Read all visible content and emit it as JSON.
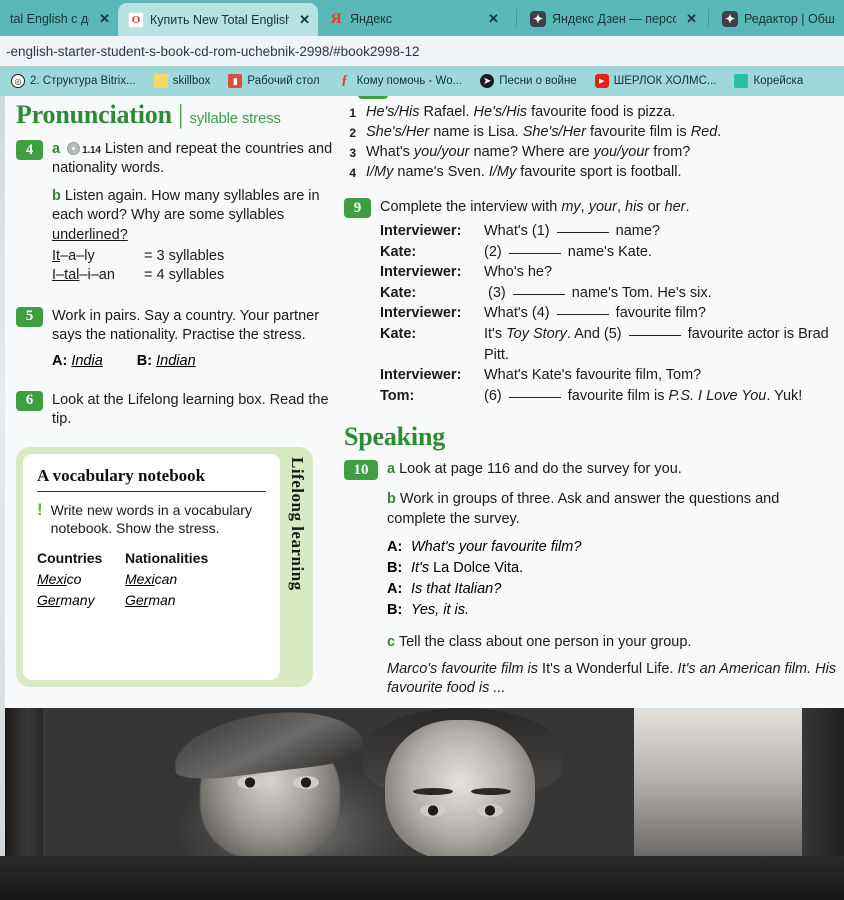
{
  "browser": {
    "tabs": [
      {
        "title": "tal English с дос",
        "icon": "none-icon",
        "active": false,
        "close": "✕"
      },
      {
        "title": "Купить New Total English",
        "icon": "opera-icon",
        "active": true,
        "close": "✕"
      },
      {
        "title": "Яндекс",
        "icon": "yandex-icon",
        "active": false,
        "close": "✕"
      },
      {
        "title": "Яндекс Дзен — персона",
        "icon": "zen-icon",
        "active": false,
        "close": "✕"
      },
      {
        "title": "Редактор | Обще",
        "icon": "zen-icon",
        "active": false,
        "close": ""
      }
    ],
    "url": "-english-starter-student-s-book-cd-rom-uchebnik-2998/#book2998-12",
    "bookmarks": [
      {
        "label": "2. Структура Bitrix...",
        "icon": "bitrix-icon"
      },
      {
        "label": "skillbox",
        "icon": "folder-icon"
      },
      {
        "label": "Рабочий стол",
        "icon": "desktop-icon"
      },
      {
        "label": "Кому помочь - Wo...",
        "icon": "word-icon"
      },
      {
        "label": "Песни о войне",
        "icon": "globe-icon"
      },
      {
        "label": "ШЕРЛОК ХОЛМС...",
        "icon": "youtube-icon"
      },
      {
        "label": "Корейска",
        "icon": "korean-icon"
      }
    ]
  },
  "colors": {
    "tab_bar": "#5bb8b8",
    "active_tab": "#b7e2e2",
    "bookmark_bar": "#9ed8da",
    "badge_green": "#3f9e3f",
    "heading_green": "#2e8b35",
    "lifelong_box": "#d9e9c2"
  },
  "left": {
    "pronunciation_heading": "Pronunciation",
    "pronunciation_bar": "|",
    "pronunciation_sub": "syllable stress",
    "ex4": {
      "number": "4",
      "a_letter": "a",
      "track": "1.14",
      "a_text": "Listen and repeat the countries and nationality words.",
      "b_letter": "b",
      "b_text_1": "Listen again. How many syllables are in each word? Why are some syllables ",
      "b_text_underlined": "underlined?",
      "syllables": [
        {
          "word_pre": "It",
          "word_post": "–a–ly",
          "count": "= 3 syllables"
        },
        {
          "word_pre": "I–tal",
          "word_post": "–i–an",
          "count": "= 4 syllables"
        }
      ]
    },
    "ex5": {
      "number": "5",
      "text": "Work in pairs. Say a country. Your partner says the nationality. Practise the stress.",
      "a_label": "A:",
      "a_word": "India",
      "b_label": "B:",
      "b_word": "Indian"
    },
    "ex6": {
      "number": "6",
      "text": "Look at the Lifelong learning box. Read the tip."
    },
    "lifelong": {
      "side_label": "Lifelong learning",
      "title": "A vocabulary notebook",
      "tip_mark": "!",
      "tip": "Write new words in a vocabulary notebook. Show the stress.",
      "col1_header": "Countries",
      "col2_header": "Nationalities",
      "rows": [
        {
          "country_pre": "Mexi",
          "country_post": "co",
          "nationality_pre": "Mexi",
          "nationality_post": "can"
        },
        {
          "country_pre": "Ger",
          "country_post": "many",
          "nationality_pre": "Ger",
          "nationality_post": "man"
        }
      ]
    }
  },
  "right": {
    "prev_items": [
      {
        "n": "1",
        "html": "<i>He's/His</i> Rafael. <i>He's/His</i> favourite food is pizza."
      },
      {
        "n": "2",
        "html": "<i>She's/Her</i> name is Lisa. <i>She's/Her</i> favourite film is <i>Red</i>."
      },
      {
        "n": "3",
        "html": "What's <i>you/your</i> name? Where are <i>you/your</i> from?"
      },
      {
        "n": "4",
        "html": "<i>I/My</i> name's Sven. <i>I/My</i> favourite sport is football."
      }
    ],
    "ex9": {
      "number": "9",
      "instruction_html": "Complete the interview with <i>my</i>, <i>your</i>, <i>his</i> or <i>her</i>.",
      "dialogue": [
        {
          "who": "Interviewer:",
          "html": "What's (1) <span class=\"blank\"></span> name?"
        },
        {
          "who": "Kate:",
          "html": "(2) <span class=\"blank\"></span> name's Kate."
        },
        {
          "who": "Interviewer:",
          "html": "Who's he?"
        },
        {
          "who": "Kate:",
          "html": "&nbsp;(3) <span class=\"blank\"></span> name's Tom. He's six."
        },
        {
          "who": "Interviewer:",
          "html": "What's (4) <span class=\"blank\"></span> favourite film?"
        },
        {
          "who": "Kate:",
          "html": "It's <i>Toy Story</i>. And (5) <span class=\"blank\"></span> favourite actor is Brad Pitt."
        },
        {
          "who": "Interviewer:",
          "html": "What's Kate's favourite film, Tom?"
        },
        {
          "who": "Tom:",
          "html": "(6) <span class=\"blank\"></span> favourite film is <i>P.S. I Love You</i>. Yuk!"
        }
      ]
    },
    "speaking_heading": "Speaking",
    "ex10": {
      "number": "10",
      "a_letter": "a",
      "a_text": "Look at page 116 and do the survey for you.",
      "b_letter": "b",
      "b_text": "Work in groups of three. Ask and answer the questions and complete the survey.",
      "exchange": [
        {
          "k": "A:",
          "html": "<i>What's your favourite film?</i>"
        },
        {
          "k": "B:",
          "html": "<i>It's</i> La Dolce Vita."
        },
        {
          "k": "A:",
          "html": "<i>Is that Italian?</i>"
        },
        {
          "k": "B:",
          "html": "<i>Yes, it is.</i>"
        }
      ],
      "c_letter": "c",
      "c_text": "Tell the class about one person in your group.",
      "example_html": "<i>Marco's favourite film is</i> It's a Wonderful Life. <i>It's an American film. His favourite food is ...</i>"
    }
  }
}
